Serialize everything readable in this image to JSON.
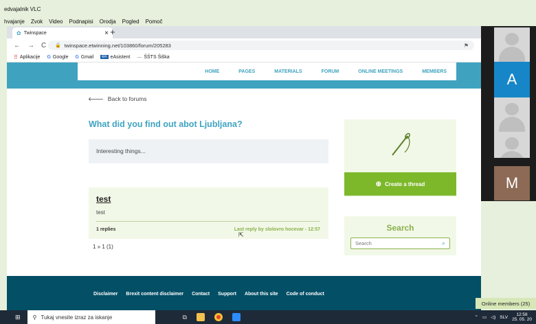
{
  "vlc": {
    "title": "edvajalnik VLC",
    "menu": [
      "hvajanje",
      "Zvok",
      "Video",
      "Podnapisi",
      "Orodja",
      "Pogled",
      "Pomoč"
    ]
  },
  "browser": {
    "tab_title": "Twinspace",
    "tab_close": "×",
    "new_tab": "+",
    "url": "twinspace.etwinning.net/103860/forum/205283",
    "bookmarks": [
      "Aplikacije",
      "Google",
      "Gmail",
      "eAsistent",
      "ŠŠTS Šiška"
    ]
  },
  "site": {
    "nav": [
      "HOME",
      "PAGES",
      "MATERIALS",
      "FORUM",
      "ONLINE MEETINGS",
      "MEMBERS"
    ],
    "back_label": "Back to forums",
    "forum_title": "What did you find out abot Ljubljana?",
    "forum_description": "Interesting things...",
    "thread": {
      "title": "test",
      "subtitle": "test",
      "replies": "1 replies",
      "last_reply": "Last reply by slolovro hocevar - 12:57"
    },
    "pager": "1 » 1 (1)",
    "create_thread_label": "Create a thread",
    "search_title": "Search",
    "search_placeholder": "Search",
    "footer_links": [
      "Disclaimer",
      "Brexit content disclaimer",
      "Contact",
      "Support",
      "About this site",
      "Code of conduct"
    ]
  },
  "video": {
    "participants": [
      "A",
      "M"
    ],
    "tile_colors": [
      "#1686c8",
      "#8c6a55"
    ]
  },
  "online_members": "Online members (25)",
  "taskbar": {
    "search_placeholder": "Tukaj vnesite izraz za iskanje",
    "language": "SLV",
    "time": "12:58",
    "date": "25. 05. 20"
  }
}
